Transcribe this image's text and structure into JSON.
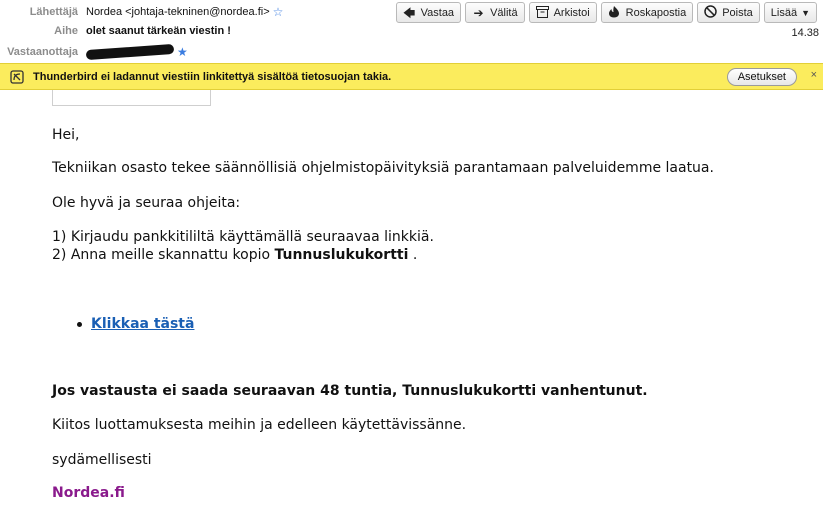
{
  "header": {
    "from_label": "Lähettäjä",
    "from_value": "Nordea <johtaja-tekninen@nordea.fi>",
    "subject_label": "Aihe",
    "subject_value": "olet saanut tärkeän viestin !",
    "to_label": "Vastaanottaja",
    "time": "14.38"
  },
  "toolbar": {
    "reply": "Vastaa",
    "forward": "Välitä",
    "archive": "Arkistoi",
    "junk": "Roskapostia",
    "delete": "Poista",
    "more": "Lisää"
  },
  "notification": {
    "text": "Thunderbird ei ladannut viestiin linkitettyä sisältöä tietosuojan takia.",
    "button": "Asetukset",
    "close": "×"
  },
  "body": {
    "greeting": "Hei,",
    "p1": "Tekniikan osasto tekee säännöllisiä ohjelmistopäivityksiä parantamaan palveluidemme laatua.",
    "p2": "Ole hyvä ja seuraa ohjeita:",
    "step1": "1) Kirjaudu pankkitililtä käyttämällä seuraavaa linkkiä.",
    "step2_prefix": "2) Anna meille skannattu kopio ",
    "step2_bold": "Tunnuslukukortti",
    "step2_suffix": " .",
    "link": "Klikkaa tästä",
    "warning": "Jos vastausta ei saada seuraavan 48 tuntia, Tunnuslukukortti vanhentunut.",
    "thanks": "Kiitos luottamuksesta meihin ja edelleen käytettävissänne.",
    "closing": "sydämellisesti",
    "signature": "Nordea.fi"
  },
  "colors": {
    "notification_bg": "#fbec5d",
    "link": "#1a5fb4",
    "signature": "#8a1a8c"
  }
}
